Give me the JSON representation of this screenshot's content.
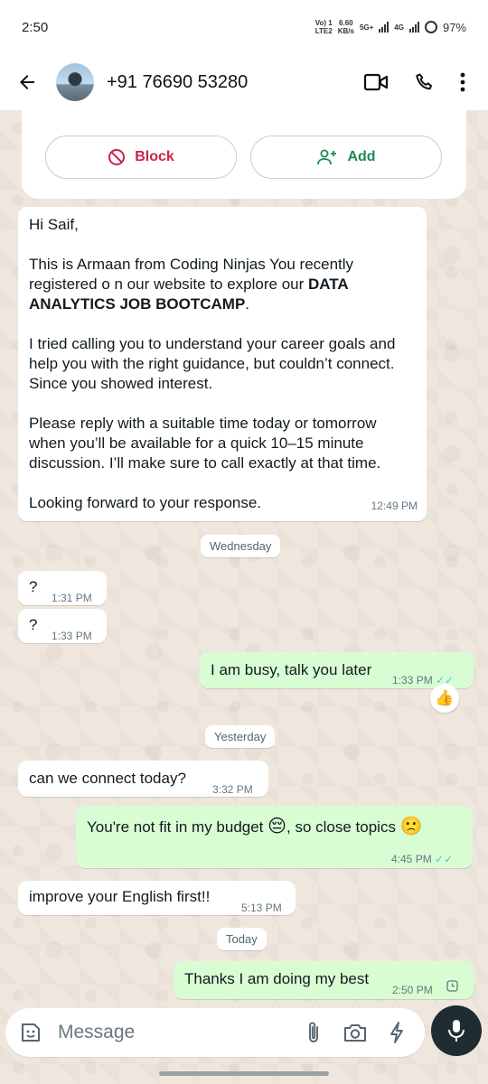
{
  "status_bar": {
    "time": "2:50",
    "volte_top": "Vo) 1",
    "volte_bottom": "LTE2",
    "speed_top": "6.60",
    "speed_bottom": "KB/s",
    "net1": "5G+",
    "net2": "4G",
    "battery": "97%"
  },
  "header": {
    "contact": "+91 76690 53280",
    "icons": [
      "back-arrow-icon",
      "video-call-icon",
      "voice-call-icon",
      "more-vert-icon"
    ]
  },
  "actions": {
    "block_label": "Block",
    "add_label": "Add",
    "block_color": "#c6264c",
    "add_color": "#1d8a55"
  },
  "messages": {
    "m1": {
      "p1": "Hi Saif,",
      "p2_pre": "This is Armaan from Coding Ninjas  You recently registered o n our website to explore our ",
      "p2_bold": "DATA ANALYTICS JOB BOOTCAMP",
      "p2_post": ".",
      "p3": "I tried calling you to understand your career goals and help you with the right guidance, but couldn’t connect. Since you showed interest.",
      "p4": "Please reply with a suitable time today or tomorrow when you’ll be available for a quick 10–15 minute discussion. I’ll make sure to call exactly at that time.",
      "p5": "Looking forward to your response.",
      "time": "12:49 PM"
    },
    "day1": "Wednesday",
    "m2": {
      "text": "?",
      "time": "1:31 PM"
    },
    "m3": {
      "text": "?",
      "time": "1:33 PM"
    },
    "m4": {
      "text": "I am busy, talk you later",
      "time": "1:33 PM",
      "ticks": "✓✓",
      "reaction": "👍"
    },
    "day2": "Yesterday",
    "m5": {
      "text": "can we connect today?",
      "time": "3:32 PM"
    },
    "m6": {
      "text_a": "You're not fit in my budget ",
      "emoji_a": "😔",
      "text_b": ", so close topics ",
      "emoji_b": "🙁",
      "time": "4:45 PM",
      "ticks": "✓✓"
    },
    "m7": {
      "text": "improve your English first!!",
      "time": "5:13 PM"
    },
    "day3": "Today",
    "m8": {
      "text": "Thanks I am doing my best",
      "time": "2:50 PM"
    }
  },
  "composer": {
    "placeholder": "Message",
    "icons": [
      "sticker-icon",
      "attach-icon",
      "camera-icon",
      "payment-bolt-icon",
      "mic-icon"
    ]
  },
  "colors": {
    "incoming": "#ffffff",
    "outgoing": "#d9fdd3",
    "read_ticks": "#53bdeb"
  }
}
